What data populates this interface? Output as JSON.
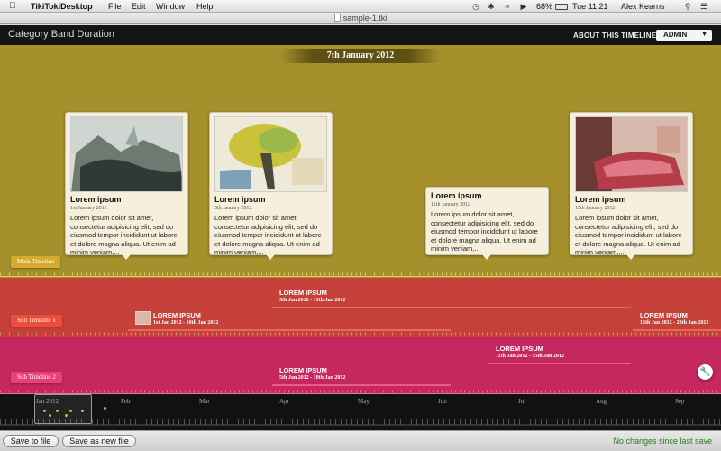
{
  "menubar": {
    "app_name": "TikiTokiDesktop",
    "menus": [
      "File",
      "Edit",
      "Window",
      "Help"
    ],
    "battery": "68%",
    "clock": "Tue 11:21",
    "user": "Alex Kearns"
  },
  "window": {
    "title": "sample-1.tki"
  },
  "header": {
    "timeline_title": "Category Band Duration",
    "about_label": "ABOUT THIS TIMELINE",
    "admin_label": "ADMIN"
  },
  "main_band": {
    "current_date": "7th January 2012",
    "band_label": "Main Timeline",
    "color": "#a5902c",
    "cards": [
      {
        "title": "Lorem ipsum",
        "date": "1st January 2012",
        "body": "Lorem ipsum dolor sit amet, consectetur adipisicing elit, sed do eiusmod tempor incididunt ut labore et dolore magna aliqua. Ut enim ad minim veniam,..."
      },
      {
        "title": "Lorem ipsum",
        "date": "5th January 2012",
        "body": "Lorem ipsum dolor sit amet, consectetur adipisicing elit, sed do eiusmod tempor incididunt ut labore et dolore magna aliqua. Ut enim ad minim veniam,..."
      },
      {
        "title": "Lorem ipsum",
        "date": "11th January 2012",
        "body": "Lorem ipsum dolor sit amet, consectetur adipisicing elit, sed do eiusmod tempor incididunt ut labore et dolore magna aliqua. Ut enim ad minim veniam,..."
      },
      {
        "title": "Lorem ipsum",
        "date": "15th January 2012",
        "body": "Lorem ipsum dolor sit amet, consectetur adipisicing elit, sed do eiusmod tempor incididunt ut labore et dolore magna aliqua. Ut enim ad minim veniam,..."
      }
    ]
  },
  "sub_timeline_1": {
    "band_label": "Sub Timeline 1",
    "color": "#c6413a",
    "events": [
      {
        "title": "LOREM IPSUM",
        "dates": "5th Jan 2012 - 15th Jan 2012"
      },
      {
        "title": "LOREM IPSUM",
        "dates": "1st Jan 2012 - 10th Jan 2012"
      },
      {
        "title": "LOREM IPSUM",
        "dates": "15th Jan 2012 - 20th Jan 2012"
      }
    ]
  },
  "sub_timeline_2": {
    "band_label": "Sub Timeline 2",
    "color": "#c5285e",
    "events": [
      {
        "title": "LOREM IPSUM",
        "dates": "11th Jan 2012 - 15th Jan 2012"
      },
      {
        "title": "LOREM IPSUM",
        "dates": "5th Jan 2012 - 10th Jan 2012"
      }
    ]
  },
  "navigator": {
    "months": [
      "Jan 2012",
      "Feb",
      "Mar",
      "Apr",
      "May",
      "Jun",
      "Jul",
      "Aug",
      "Sep"
    ]
  },
  "footer": {
    "save_label": "Save to file",
    "save_as_label": "Save as new file",
    "status": "No changes since last save"
  }
}
